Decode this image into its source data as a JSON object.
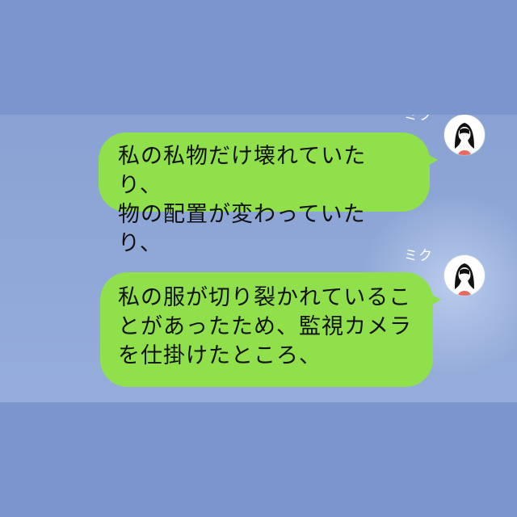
{
  "chat": {
    "messages": [
      {
        "sender": "ミク",
        "text": "私の私物だけ壊れていたり、\n物の配置が変わっていたり、"
      },
      {
        "sender": "ミク",
        "text": "私の服が切り裂かれているこ\nとがあったため、監視カメラ\nを仕掛けたところ、"
      }
    ]
  },
  "colors": {
    "background": "#7a96cc",
    "chat_background": "#8ea7d6",
    "bubble": "#8fe04a",
    "name_text": "#ffffff",
    "hair": "#111111",
    "shirt": "#e66a62"
  },
  "icons": {
    "avatar_icon": "girl-avatar-icon"
  }
}
